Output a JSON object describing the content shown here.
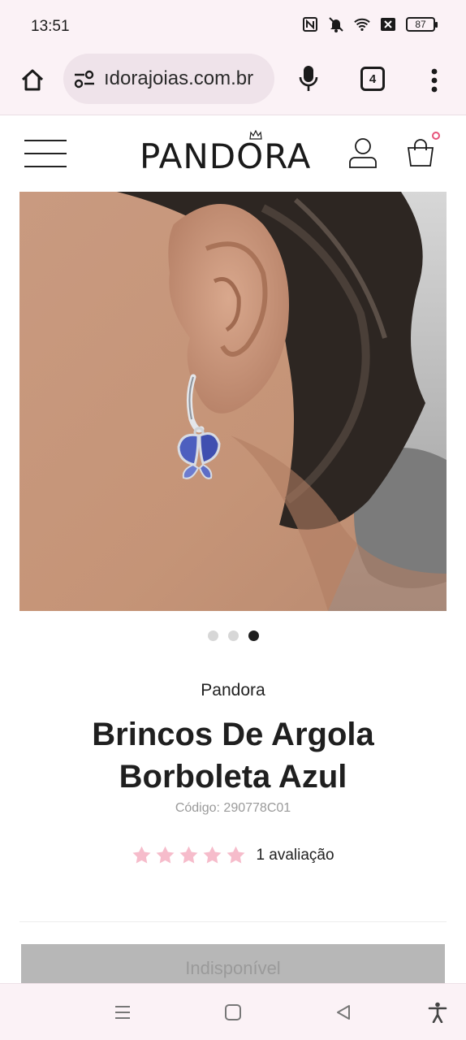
{
  "status": {
    "time": "13:51",
    "battery": "87",
    "icons": [
      "nfc-icon",
      "bell-muted-icon",
      "wifi-icon",
      "signal-off-icon",
      "battery-icon"
    ]
  },
  "browser": {
    "url": "ıdorajoias.com.br",
    "tab_count": "4"
  },
  "header": {
    "logo": "PANDORA"
  },
  "gallery": {
    "slides": 3,
    "active_slide": 3
  },
  "product": {
    "brand": "Pandora",
    "title_line1": "Brincos De Argola",
    "title_line2": "Borboleta Azul",
    "code": "Código: 290778C01",
    "rating_stars": 5,
    "rating_text": "1 avaliação",
    "cta": "Indisponível"
  },
  "colors": {
    "chrome_bg": "#fbf2f6",
    "star": "#f6bccb",
    "cart_dot": "#e6537a",
    "button_disabled": "#b7b7b7"
  }
}
